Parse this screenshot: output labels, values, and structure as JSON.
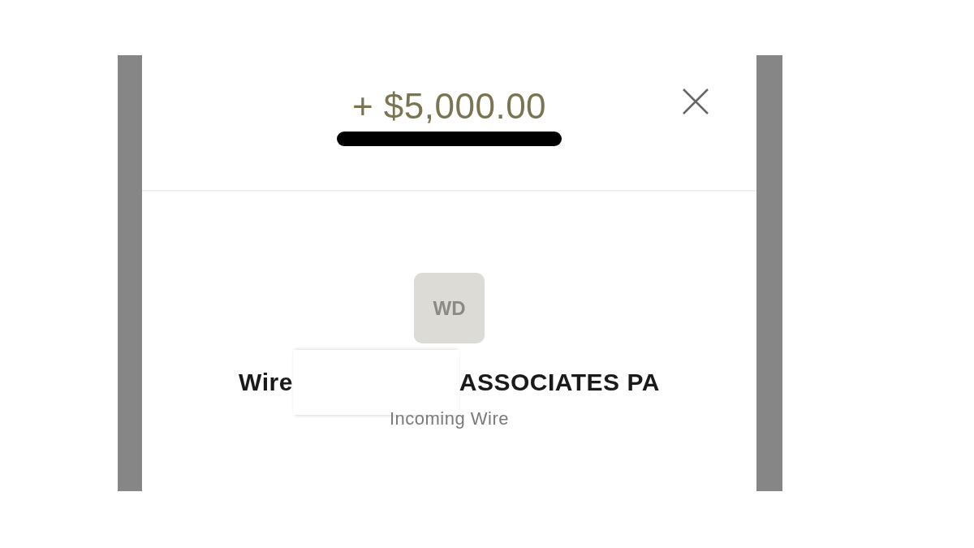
{
  "header": {
    "amount": "+ $5,000.00"
  },
  "payee": {
    "initials": "WD",
    "name_parts": [
      "Wire",
      "ASSOCIATES PA"
    ],
    "type": "Incoming Wire"
  }
}
